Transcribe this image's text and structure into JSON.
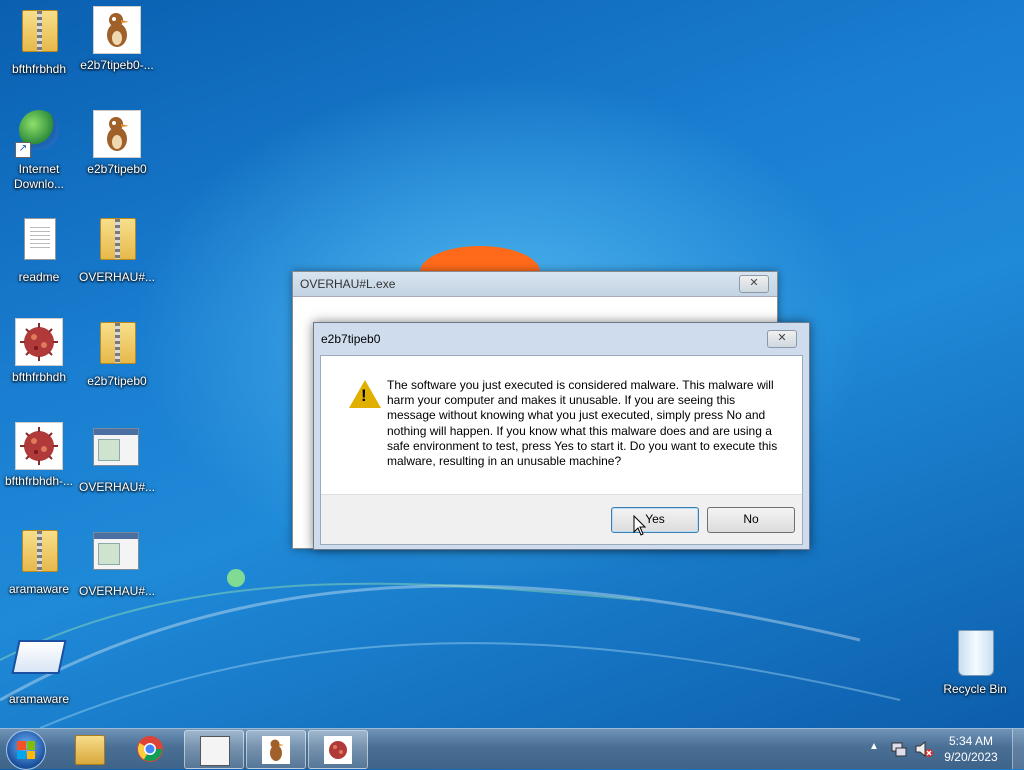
{
  "desktop": {
    "icons": [
      {
        "label": "bfthfrbhdh",
        "icon": "zip-folder-icon"
      },
      {
        "label": "e2b7tipeb0-...",
        "icon": "bird-image-icon"
      },
      {
        "label": "Internet Downlo...",
        "icon": "internet-download-manager-icon"
      },
      {
        "label": "e2b7tipeb0",
        "icon": "bird-image-icon"
      },
      {
        "label": "readme",
        "icon": "text-file-icon"
      },
      {
        "label": "OVERHAU#...",
        "icon": "zip-folder-icon"
      },
      {
        "label": "bfthfrbhdh",
        "icon": "virus-image-icon"
      },
      {
        "label": "e2b7tipeb0",
        "icon": "zip-folder-icon"
      },
      {
        "label": "bfthfrbhdh-...",
        "icon": "virus-image-icon"
      },
      {
        "label": "OVERHAU#...",
        "icon": "application-window-icon"
      },
      {
        "label": "aramaware",
        "icon": "zip-folder-icon"
      },
      {
        "label": "OVERHAU#...",
        "icon": "application-window-icon"
      },
      {
        "label": "aramaware",
        "icon": "program-shortcut-icon"
      },
      {
        "label": "Recycle Bin",
        "icon": "recycle-bin-icon"
      }
    ]
  },
  "back_window": {
    "title": "OVERHAU#L.exe",
    "close_label": "✕"
  },
  "dialog": {
    "title": "e2b7tipeb0",
    "close_label": "✕",
    "icon": "warning-icon",
    "message": "The software you just executed is considered malware. This malware will harm your computer and makes it unusable. If you are seeing this message without knowing what you just executed, simply press No and nothing will happen. If you know what this malware does and are using a safe environment to test, press Yes to start it. Do you want to execute this malware, resulting in an unusable machine?",
    "yes_label": "Yes",
    "no_label": "No"
  },
  "taskbar": {
    "items": [
      "start-orb-icon",
      "file-explorer-icon",
      "chrome-icon",
      "application-window-icon",
      "bird-image-icon",
      "virus-image-icon"
    ],
    "tray_icons": [
      "show-hidden-icons-icon",
      "network-icon",
      "volume-muted-icon"
    ],
    "time": "5:34 AM",
    "date": "9/20/2023"
  },
  "colors": {
    "desktop_blue": "#1a7ed1",
    "warning_yellow": "#e0b000",
    "taskbar": "#4a6f94"
  }
}
